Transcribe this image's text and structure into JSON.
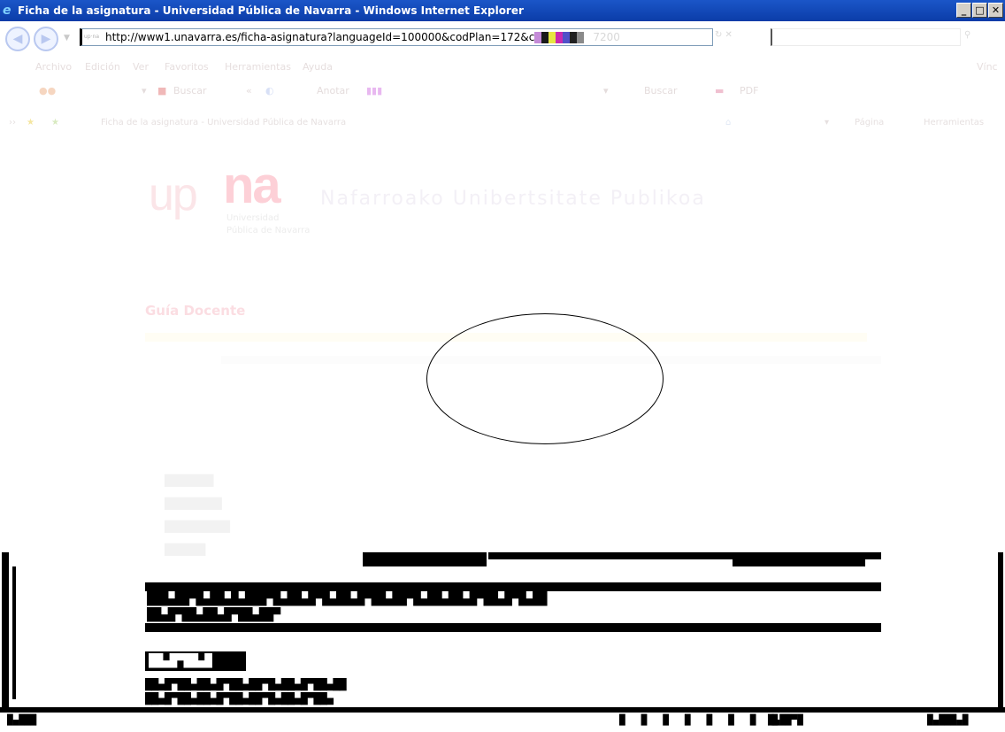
{
  "window": {
    "title": "Ficha de la asignatura - Universidad Pública de Navarra - Windows Internet Explorer",
    "controls": [
      "_",
      "□",
      "✕"
    ]
  },
  "address_bar": {
    "favicon_text": "up·na",
    "url": "http://www1.unavarra.es/ficha-asignatura?languageId=100000&codPlan=172&c",
    "url_tail": "7200"
  },
  "menu": {
    "items": [
      "Archivo",
      "Edición",
      "Ver",
      "Favoritos",
      "Herramientas",
      "Ayuda"
    ],
    "right": "Vínc"
  },
  "toolbar": {
    "buscar": "Buscar",
    "arrow": "«",
    "anotar": "Anotar",
    "buscar2": "Buscar",
    "pdf": "PDF"
  },
  "favorites": {
    "tab_title": "Ficha de la asignatura - Universidad Pública de Navarra",
    "pagina": "Página",
    "herramientas": "Herramientas"
  },
  "page": {
    "logo_up": "up",
    "logo_na": "na",
    "logo_sub1": "Universidad",
    "logo_sub2": "Pública de Navarra",
    "site_title": "Nafarroako Unibertsitate Publikoa",
    "section_head": "Guía Docente"
  },
  "glitch": {
    "line1": "███▄██▀█▄██▄█▄███▀█▄██▄█▀█▄██▄█▀██▄██▀█▄██▄██▄█▀██▄█▀█▄██",
    "line2": "██▄█▀██▄██▄█▀██▄██▀",
    "head2": "██▄█▀██▄█",
    "line3": "██▄█▀██▄██▄█▀██▄██▀█▄██▄█▀██▄██",
    "line4": "██▄█▀██▄██▄█▀██▄██▀█▄██▄█▀██▄",
    "status_left": "█▄███",
    "status_mid": "█▄██▀█",
    "status_right": "█▄███▄█"
  }
}
